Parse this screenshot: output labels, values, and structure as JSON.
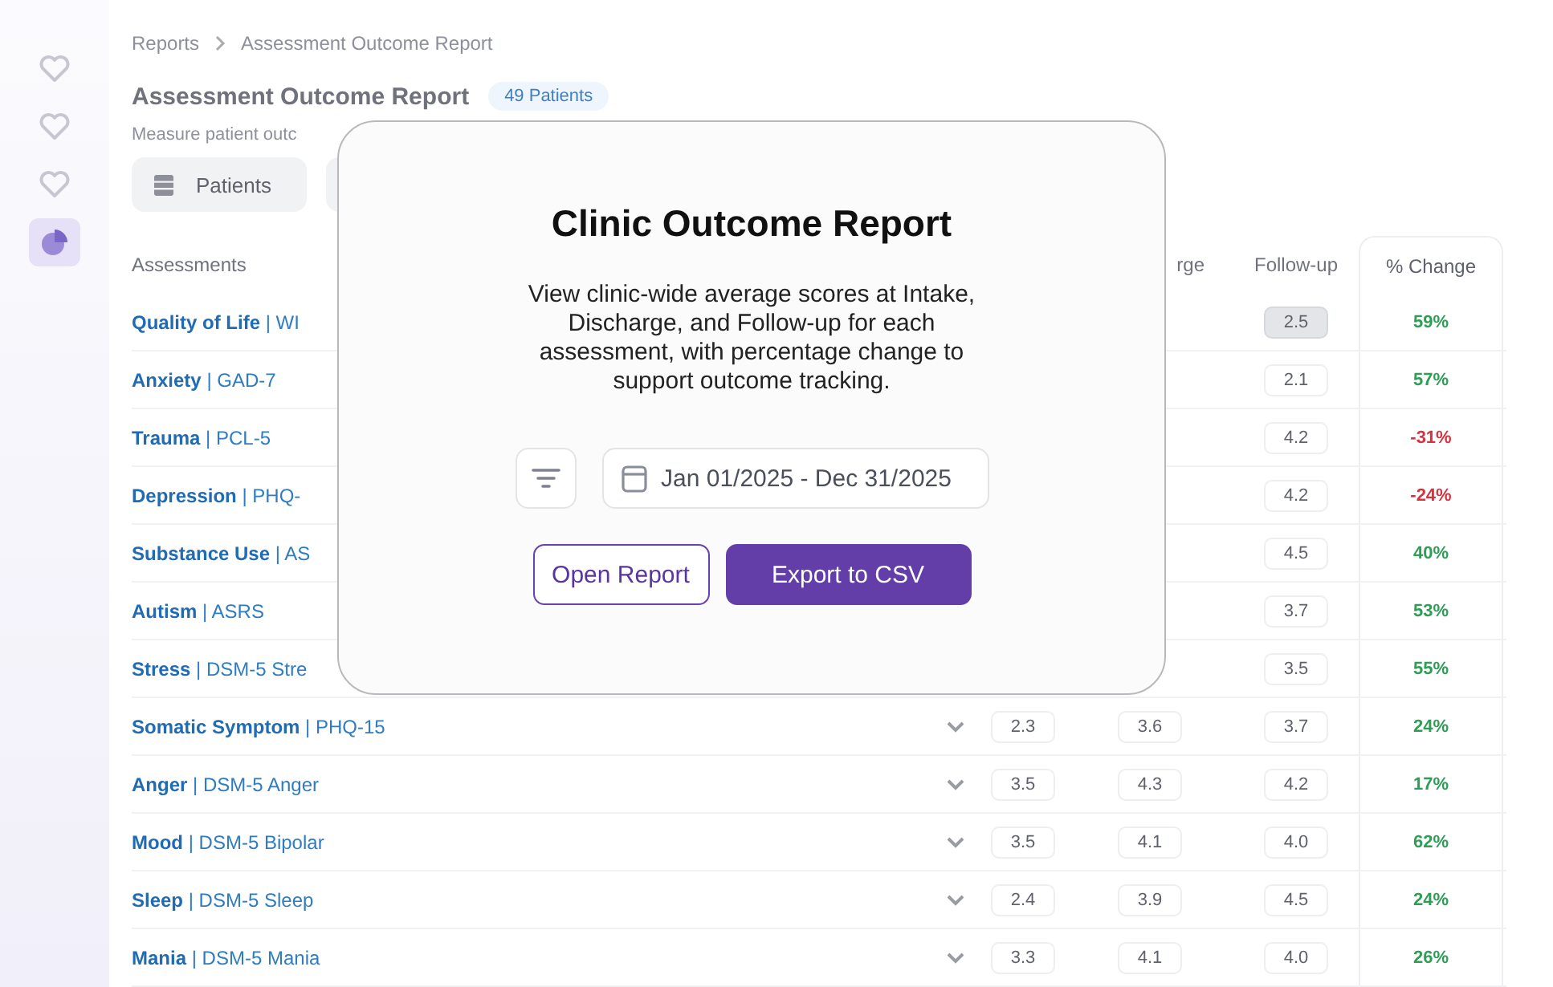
{
  "sidebar": {
    "items": [
      {
        "selected": false
      },
      {
        "selected": false
      },
      {
        "selected": false
      },
      {
        "selected": true
      }
    ]
  },
  "breadcrumb": [
    "Reports",
    "Assessment Outcome Report"
  ],
  "page": {
    "title": "Assessment Outcome Report",
    "badge": "49 Patients",
    "subtitle": "Measure patient outc"
  },
  "tabs": [
    {
      "label": "Patients"
    }
  ],
  "table": {
    "columns": {
      "name": "Assessments",
      "column_3": "rge",
      "follow_up": "Follow-up",
      "change": "% Change"
    },
    "rows": [
      {
        "name": "**Quality of Life** | WI",
        "follow_up": "2.5",
        "change": "59%",
        "color": "#2f9e55",
        "highlighted": true
      },
      {
        "name": "**Anxiety** | GAD-7",
        "follow_up": "2.1",
        "change": "57%",
        "color": "#2f9e55",
        "highlighted": false
      },
      {
        "name": "**Trauma** | PCL-5",
        "follow_up": "4.2",
        "change": "-31%",
        "color": "#d8323f",
        "highlighted": false
      },
      {
        "name": "**Depression** | PHQ-",
        "follow_up": "4.2",
        "change": "-24%",
        "color": "#d8323f",
        "highlighted": false
      },
      {
        "name": "**Substance Use** | AS",
        "follow_up": "4.5",
        "change": "40%",
        "color": "#2f9e55",
        "highlighted": false
      },
      {
        "name": "**Autism** | ASRS",
        "follow_up": "3.7",
        "change": "53%",
        "color": "#2f9e55",
        "highlighted": false
      },
      {
        "name": "**Stress** | DSM-5 Stre",
        "follow_up": "3.5",
        "change": "55%",
        "color": "#2f9e55",
        "highlighted": false
      },
      {
        "name": "**Somatic Symptom** | PHQ-15",
        "intake": "2.3",
        "discharge": "3.6",
        "follow_up": "3.7",
        "change": "24%",
        "color": "#2f9e55",
        "highlighted": false
      },
      {
        "name": "**Anger** | DSM-5 Anger",
        "intake": "3.5",
        "discharge": "4.3",
        "follow_up": "4.2",
        "change": "17%",
        "color": "#2f9e55",
        "highlighted": false
      },
      {
        "name": "**Mood** | DSM-5 Bipolar",
        "intake": "3.5",
        "discharge": "4.1",
        "follow_up": "4.0",
        "change": "62%",
        "color": "#2f9e55",
        "highlighted": false
      },
      {
        "name": "**Sleep** | DSM-5 Sleep",
        "intake": "2.4",
        "discharge": "3.9",
        "follow_up": "4.5",
        "change": "24%",
        "color": "#2f9e55",
        "highlighted": false
      },
      {
        "name": "**Mania** | DSM-5 Mania",
        "intake": "3.3",
        "discharge": "4.1",
        "follow_up": "4.0",
        "change": "26%",
        "color": "#2f9e55",
        "highlighted": false
      }
    ]
  },
  "dialog": {
    "title": "Clinic Outcome Report",
    "description": "View clinic-wide average scores at Intake, Discharge, and Follow-up for each assessment, with percentage change to support outcome tracking.",
    "date_range": "Jan 01/2025 - Dec 31/2025",
    "buttons": [
      {
        "label": "Open Report",
        "kind": "outline"
      },
      {
        "label": "Export to CSV",
        "kind": "primary"
      }
    ]
  }
}
